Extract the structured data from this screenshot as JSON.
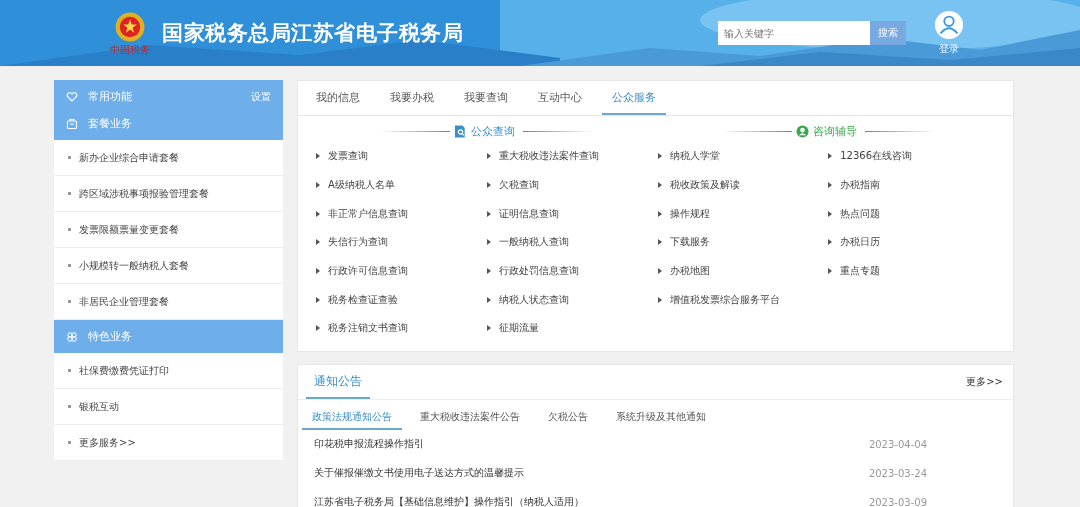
{
  "header": {
    "emblem_caption": "中国税务",
    "title": "国家税务总局江苏省电子税务局",
    "search": {
      "placeholder": "输入关键字",
      "button": "搜索"
    },
    "login": "登录"
  },
  "sidebar": [
    {
      "kind": "header",
      "label": "常用功能",
      "action": "设置"
    },
    {
      "kind": "header",
      "label": "套餐业务"
    },
    {
      "kind": "item",
      "label": "新办企业综合申请套餐"
    },
    {
      "kind": "item",
      "label": "跨区域涉税事项报验管理套餐"
    },
    {
      "kind": "item",
      "label": "发票限额票量变更套餐"
    },
    {
      "kind": "item",
      "label": "小规模转一般纳税人套餐"
    },
    {
      "kind": "item",
      "label": "非居民企业管理套餐"
    },
    {
      "kind": "header",
      "label": "特色业务"
    },
    {
      "kind": "item",
      "label": "社保费缴费凭证打印"
    },
    {
      "kind": "item",
      "label": "银税互动"
    },
    {
      "kind": "item",
      "label": "更多服务>>"
    }
  ],
  "tabs": [
    {
      "label": "我的信息",
      "selected": false
    },
    {
      "label": "我要办税",
      "selected": false
    },
    {
      "label": "我要查询",
      "selected": false
    },
    {
      "label": "互动中心",
      "selected": false
    },
    {
      "label": "公众服务",
      "selected": true
    }
  ],
  "sections": [
    {
      "title": "公众查询",
      "color": "#3a8fc8",
      "columns": [
        [
          "发票查询",
          "A级纳税人名单",
          "非正常户信息查询",
          "失信行为查询",
          "行政许可信息查询",
          "税务检查证查验",
          "税务注销文书查询"
        ],
        [
          "重大税收违法案件查询",
          "欠税查询",
          "证明信息查询",
          "一般纳税人查询",
          "行政处罚信息查询",
          "纳税人状态查询",
          "征期流量"
        ]
      ]
    },
    {
      "title": "咨询辅导",
      "color": "#3aa84a",
      "columns": [
        [
          "纳税人学堂",
          "税收政策及解读",
          "操作规程",
          "下载服务",
          "办税地图",
          "增值税发票综合服务平台"
        ],
        [
          "12366在线咨询",
          "办税指南",
          "热点问题",
          "办税日历",
          "重点专题"
        ]
      ]
    }
  ],
  "notices": {
    "title": "通知公告",
    "more": "更多>>",
    "tabs": [
      {
        "label": "政策法规通知公告",
        "selected": true
      },
      {
        "label": "重大税收违法案件公告",
        "selected": false
      },
      {
        "label": "欠税公告",
        "selected": false
      },
      {
        "label": "系统升级及其他通知",
        "selected": false
      }
    ],
    "rows": [
      {
        "title": "印花税申报流程操作指引",
        "date": "2023-04-04"
      },
      {
        "title": "关于催报催缴文书使用电子送达方式的温馨提示",
        "date": "2023-03-24"
      },
      {
        "title": "江苏省电子税务局【基础信息维护】操作指引（纳税人适用）",
        "date": "2023-03-09"
      }
    ]
  }
}
